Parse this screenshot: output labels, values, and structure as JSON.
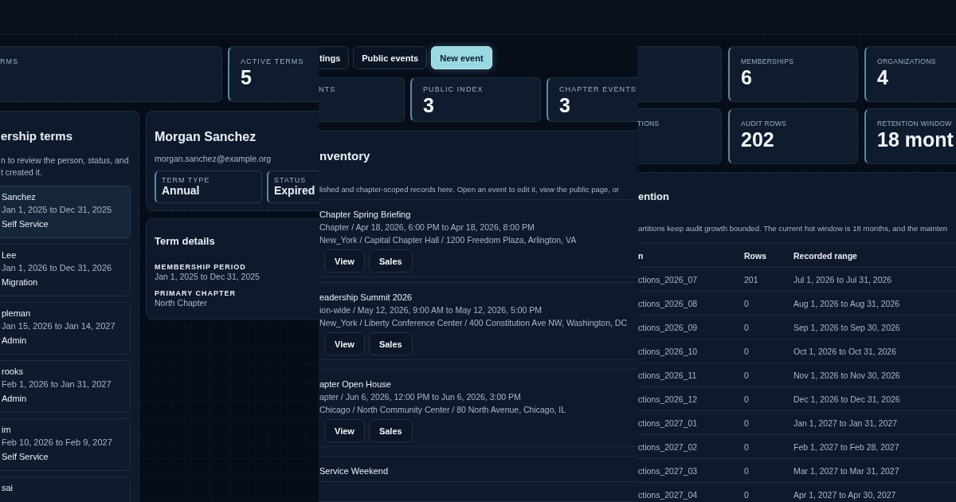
{
  "membership_view": {
    "stats": [
      {
        "label": "RMS"
      },
      {
        "label": "ACTIVE TERMS",
        "value": "5"
      }
    ],
    "terms_list": {
      "title": "ership terms",
      "description_lines": [
        "n to review the person, status, and",
        "t created it."
      ],
      "items": [
        {
          "name": "Sanchez",
          "period": "Jan 1, 2025 to Dec 31, 2025",
          "source": "Self Service",
          "selected": true
        },
        {
          "name": "Lee",
          "period": "Jan 1, 2026 to Dec 31, 2026",
          "source": "Migration",
          "selected": false
        },
        {
          "name": "pleman",
          "period": "Jan 15, 2026 to Jan 14, 2027",
          "source": "Admin",
          "selected": false
        },
        {
          "name": "rooks",
          "period": "Feb 1, 2026 to Jan 31, 2027",
          "source": "Admin",
          "selected": false
        },
        {
          "name": "im",
          "period": "Feb 10, 2026 to Feb 9, 2027",
          "source": "Self Service",
          "selected": false
        },
        {
          "name": "sai",
          "selected": false
        }
      ]
    },
    "detail": {
      "name": "Morgan Sanchez",
      "email": "morgan.sanchez@example.org",
      "fields": [
        {
          "label": "TERM TYPE",
          "value": "Annual"
        },
        {
          "label": "STATUS",
          "value": "Expired"
        }
      ]
    },
    "term_details": {
      "title": "Term details",
      "fields": [
        {
          "label": "MEMBERSHIP PERIOD",
          "value": "Jan 1, 2025 to Dec 31, 2025"
        },
        {
          "label": "PRIMARY CHAPTER",
          "value": "North Chapter"
        }
      ]
    }
  },
  "events_view": {
    "toolbar": [
      {
        "label": "tings",
        "kind": "secondary"
      },
      {
        "label": "Public events",
        "kind": "secondary"
      },
      {
        "label": "New event",
        "kind": "primary"
      }
    ],
    "stats": [
      {
        "label": "NTS"
      },
      {
        "label": "PUBLIC INDEX",
        "value": "3"
      },
      {
        "label": "CHAPTER EVENTS",
        "value": "3"
      }
    ],
    "inventory": {
      "title": "nventory",
      "description": "lished and chapter-scoped records here. Open an event to edit it, view the public page, or",
      "events": [
        {
          "title": "Chapter Spring Briefing",
          "schedule": "Chapter / Apr 18, 2026, 6:00 PM to Apr 18, 2026, 8:00 PM",
          "venue": "New_York / Capital Chapter Hall / 1200 Freedom Plaza, Arlington, VA",
          "actions": [
            "View",
            "Sales"
          ]
        },
        {
          "title": "eadership Summit 2026",
          "schedule": "ion-wide / May 12, 2026, 9:00 AM to May 12, 2026, 5:00 PM",
          "venue": "New_York / Liberty Conference Center / 400 Constitution Ave NW, Washington, DC",
          "actions": [
            "View",
            "Sales"
          ]
        },
        {
          "title": "apter Open House",
          "schedule": "apter / Jun 6, 2026, 12:00 PM to Jun 6, 2026, 3:00 PM",
          "venue": "Chicago / North Community Center / 80 North Avenue, Chicago, IL",
          "actions": [
            "View",
            "Sales"
          ]
        },
        {
          "title": "Service Weekend"
        }
      ]
    }
  },
  "audit_view": {
    "stats": [
      {
        "label": "MEMBERSHIPS",
        "value": "6"
      },
      {
        "label": "ORGANIZATIONS",
        "value": "4"
      },
      {
        "label": "TIONS"
      },
      {
        "label": "AUDIT ROWS",
        "value": "202"
      },
      {
        "label": "RETENTION WINDOW",
        "value": "18 mont"
      }
    ],
    "retention": {
      "title": "ention",
      "description": "artitions keep audit growth bounded. The current hot window is 18 months, and the mainten",
      "columns": [
        "n",
        "Rows",
        "Recorded range"
      ],
      "rows": [
        [
          "ctions_2026_07",
          "201",
          "Jul 1, 2026 to Jul 31, 2026"
        ],
        [
          "ctions_2026_08",
          "0",
          "Aug 1, 2026 to Aug 31, 2026"
        ],
        [
          "ctions_2026_09",
          "0",
          "Sep 1, 2026 to Sep 30, 2026"
        ],
        [
          "ctions_2026_10",
          "0",
          "Oct 1, 2026 to Oct 31, 2026"
        ],
        [
          "ctions_2026_11",
          "0",
          "Nov 1, 2026 to Nov 30, 2026"
        ],
        [
          "ctions_2026_12",
          "0",
          "Dec 1, 2026 to Dec 31, 2026"
        ],
        [
          "ctions_2027_01",
          "0",
          "Jan 1, 2027 to Jan 31, 2027"
        ],
        [
          "ctions_2027_02",
          "0",
          "Feb 1, 2027 to Feb 28, 2027"
        ],
        [
          "ctions_2027_03",
          "0",
          "Mar 1, 2027 to Mar 31, 2027"
        ],
        [
          "ctions_2027_04",
          "0",
          "Apr 1, 2027 to Apr 30, 2027"
        ]
      ]
    }
  }
}
